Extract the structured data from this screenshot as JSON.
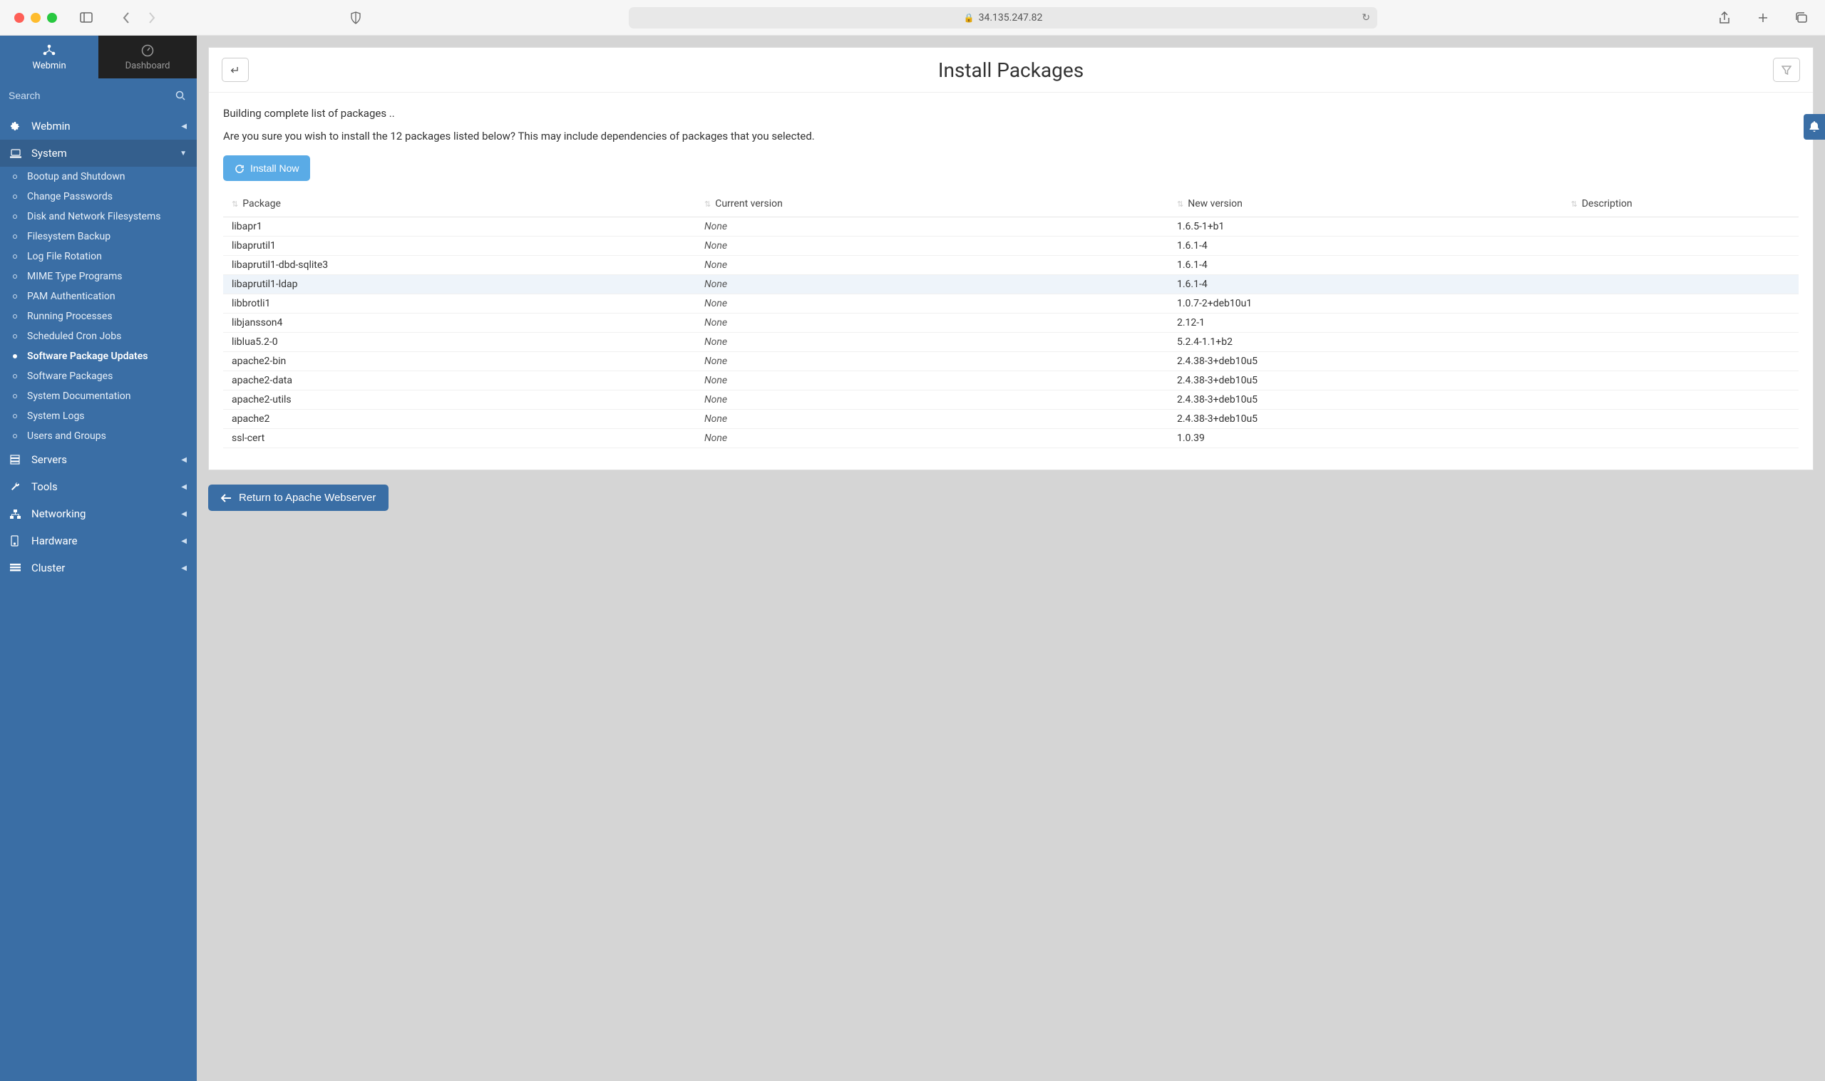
{
  "browser": {
    "url": "34.135.247.82"
  },
  "tabs": {
    "webmin": "Webmin",
    "dashboard": "Dashboard"
  },
  "search": {
    "placeholder": "Search"
  },
  "nav": {
    "webmin": "Webmin",
    "system": "System",
    "servers": "Servers",
    "tools": "Tools",
    "networking": "Networking",
    "hardware": "Hardware",
    "cluster": "Cluster",
    "system_items": [
      "Bootup and Shutdown",
      "Change Passwords",
      "Disk and Network Filesystems",
      "Filesystem Backup",
      "Log File Rotation",
      "MIME Type Programs",
      "PAM Authentication",
      "Running Processes",
      "Scheduled Cron Jobs",
      "Software Package Updates",
      "Software Packages",
      "System Documentation",
      "System Logs",
      "Users and Groups"
    ]
  },
  "page": {
    "title": "Install Packages",
    "status": "Building complete list of packages ..",
    "confirm": "Are you sure you wish to install the 12 packages listed below? This may include dependencies of packages that you selected.",
    "install_btn": "Install Now",
    "return_btn": "Return to Apache Webserver"
  },
  "table": {
    "headers": {
      "pkg": "Package",
      "cur": "Current version",
      "new": "New version",
      "desc": "Description"
    },
    "rows": [
      {
        "pkg": "libapr1",
        "cur": "None",
        "new": "1.6.5-1+b1",
        "desc": ""
      },
      {
        "pkg": "libaprutil1",
        "cur": "None",
        "new": "1.6.1-4",
        "desc": ""
      },
      {
        "pkg": "libaprutil1-dbd-sqlite3",
        "cur": "None",
        "new": "1.6.1-4",
        "desc": ""
      },
      {
        "pkg": "libaprutil1-ldap",
        "cur": "None",
        "new": "1.6.1-4",
        "desc": ""
      },
      {
        "pkg": "libbrotli1",
        "cur": "None",
        "new": "1.0.7-2+deb10u1",
        "desc": ""
      },
      {
        "pkg": "libjansson4",
        "cur": "None",
        "new": "2.12-1",
        "desc": ""
      },
      {
        "pkg": "liblua5.2-0",
        "cur": "None",
        "new": "5.2.4-1.1+b2",
        "desc": ""
      },
      {
        "pkg": "apache2-bin",
        "cur": "None",
        "new": "2.4.38-3+deb10u5",
        "desc": ""
      },
      {
        "pkg": "apache2-data",
        "cur": "None",
        "new": "2.4.38-3+deb10u5",
        "desc": ""
      },
      {
        "pkg": "apache2-utils",
        "cur": "None",
        "new": "2.4.38-3+deb10u5",
        "desc": ""
      },
      {
        "pkg": "apache2",
        "cur": "None",
        "new": "2.4.38-3+deb10u5",
        "desc": ""
      },
      {
        "pkg": "ssl-cert",
        "cur": "None",
        "new": "1.0.39",
        "desc": ""
      }
    ]
  }
}
